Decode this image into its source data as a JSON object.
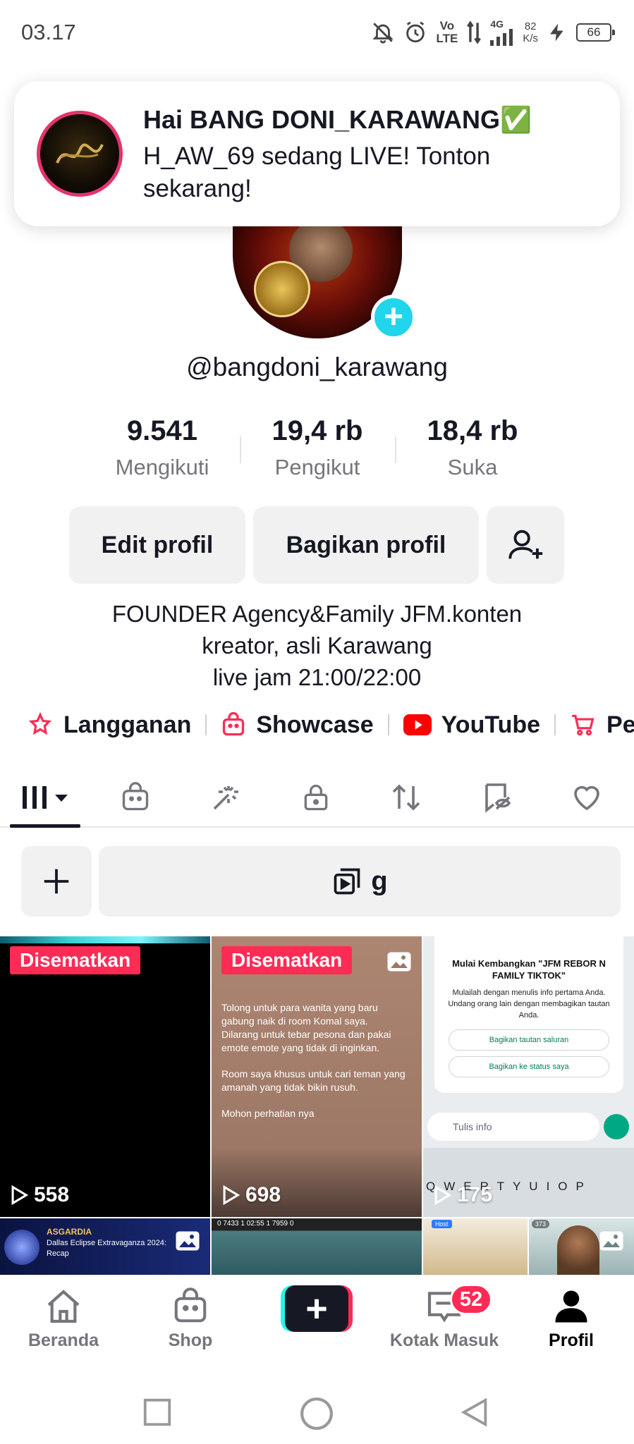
{
  "status_bar": {
    "time": "03.17",
    "network_volte_line1": "Vo",
    "network_volte_line2": "LTE",
    "network_type": "4G",
    "speed_value": "82",
    "speed_unit": "K/s",
    "battery": "66"
  },
  "notification": {
    "title": "Hai BANG DONI_KARAWANG✅",
    "body": "H_AW_69 sedang LIVE! Tonton sekarang!"
  },
  "profile": {
    "username": "@bangdoni_karawang",
    "stats": [
      {
        "value": "9.541",
        "label": "Mengikuti"
      },
      {
        "value": "19,4 rb",
        "label": "Pengikut"
      },
      {
        "value": "18,4 rb",
        "label": "Suka"
      }
    ],
    "edit_button": "Edit profil",
    "share_button": "Bagikan profil",
    "bio": [
      "FOUNDER Agency&Family JFM.konten",
      "kreator, asli Karawang",
      "live jam 21:00/22:00"
    ],
    "links": [
      "Langganan",
      "Showcase",
      "YouTube",
      "Pe"
    ]
  },
  "toolbar": {
    "search_text": "g"
  },
  "grid": {
    "pinned_label": "Disematkan",
    "videos": [
      {
        "views": "558",
        "pinned": true
      },
      {
        "views": "698",
        "pinned": true
      },
      {
        "views": "175",
        "pinned": false
      }
    ],
    "cell2_text": [
      "Tolong untuk para wanita yang baru gabung naik di room Komal saya.\nDilarang untuk tebar pesona dan pakai emote emote yang tidak di inginkan.",
      "Room saya khusus untuk cari teman yang amanah yang tidak bikin rusuh.",
      "Mohon perhatian nya"
    ],
    "cell3": {
      "heading": "Mulai Kembangkan \"JFM REBOR N FAMILY TIKTOK\"",
      "desc": "Mulailah dengan menulis info pertama Anda. Undang orang lain dengan membagikan tautan Anda.",
      "btn1": "Bagikan tautan saluran",
      "btn2": "Bagikan ke status saya",
      "input": "Tulis info",
      "keys": "QWERTYUIOP"
    },
    "cell4": {
      "title": "ASGARDIA",
      "subtitle": "Dallas Eclipse Extravaganza 2024: Recap"
    },
    "cell5": {
      "hud": "0 7433 1 02:55 1 7959 0"
    },
    "cell6": {
      "host": "Host",
      "count": "373"
    }
  },
  "bottom_nav": [
    {
      "label": "Beranda",
      "icon": "home-icon"
    },
    {
      "label": "Shop",
      "icon": "shop-bag-icon"
    },
    {
      "label": "",
      "icon": "create-plus-icon"
    },
    {
      "label": "Kotak Masuk",
      "icon": "inbox-icon",
      "badge": "52"
    },
    {
      "label": "Profil",
      "icon": "profile-icon"
    }
  ],
  "colors": {
    "accent_red": "#fe2c55",
    "accent_cyan": "#25f4ee",
    "text_primary": "#161823",
    "text_secondary": "#75767c"
  }
}
